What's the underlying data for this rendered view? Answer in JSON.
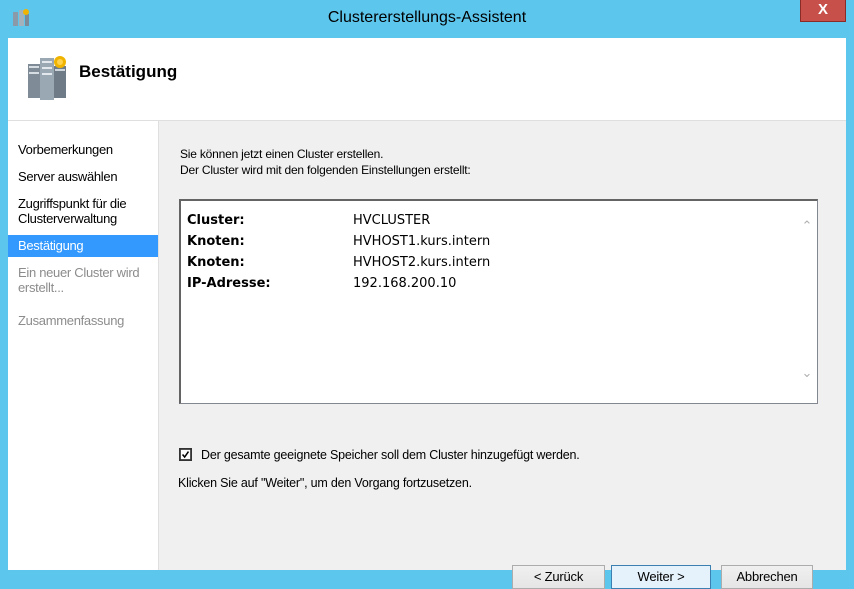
{
  "window": {
    "title": "Clustererstellungs-Assistent",
    "close_label": "X"
  },
  "header": {
    "title": "Bestätigung"
  },
  "sidebar": {
    "steps": [
      {
        "label": "Vorbemerkungen",
        "state": "normal"
      },
      {
        "label": "Server auswählen",
        "state": "normal"
      },
      {
        "label": "Zugriffspunkt für die Clusterverwaltung",
        "state": "normal"
      },
      {
        "label": "Bestätigung",
        "state": "active"
      },
      {
        "label": "Ein neuer Cluster wird erstellt...",
        "state": "disabled"
      },
      {
        "label": "Zusammenfassung",
        "state": "disabled"
      }
    ]
  },
  "main": {
    "intro_line1": "Sie können jetzt einen Cluster erstellen.",
    "intro_line2": "Der Cluster wird mit den folgenden Einstellungen erstellt:",
    "summary": [
      {
        "key": "Cluster:",
        "value": "HVCLUSTER"
      },
      {
        "key": "Knoten:",
        "value": "HVHOST1.kurs.intern"
      },
      {
        "key": "Knoten:",
        "value": "HVHOST2.kurs.intern"
      },
      {
        "key": "IP-Adresse:",
        "value": "192.168.200.10"
      }
    ],
    "checkbox_label": "Der gesamte geeignete Speicher soll dem Cluster hinzugefügt werden.",
    "checkbox_checked": true,
    "hint": "Klicken Sie auf \"Weiter\", um den Vorgang fortzusetzen."
  },
  "buttons": {
    "back": "< Zurück",
    "next": "Weiter >",
    "cancel": "Abbrechen"
  },
  "colors": {
    "frame": "#5dc6ed",
    "selection": "#3399ff",
    "close": "#c7504b"
  }
}
